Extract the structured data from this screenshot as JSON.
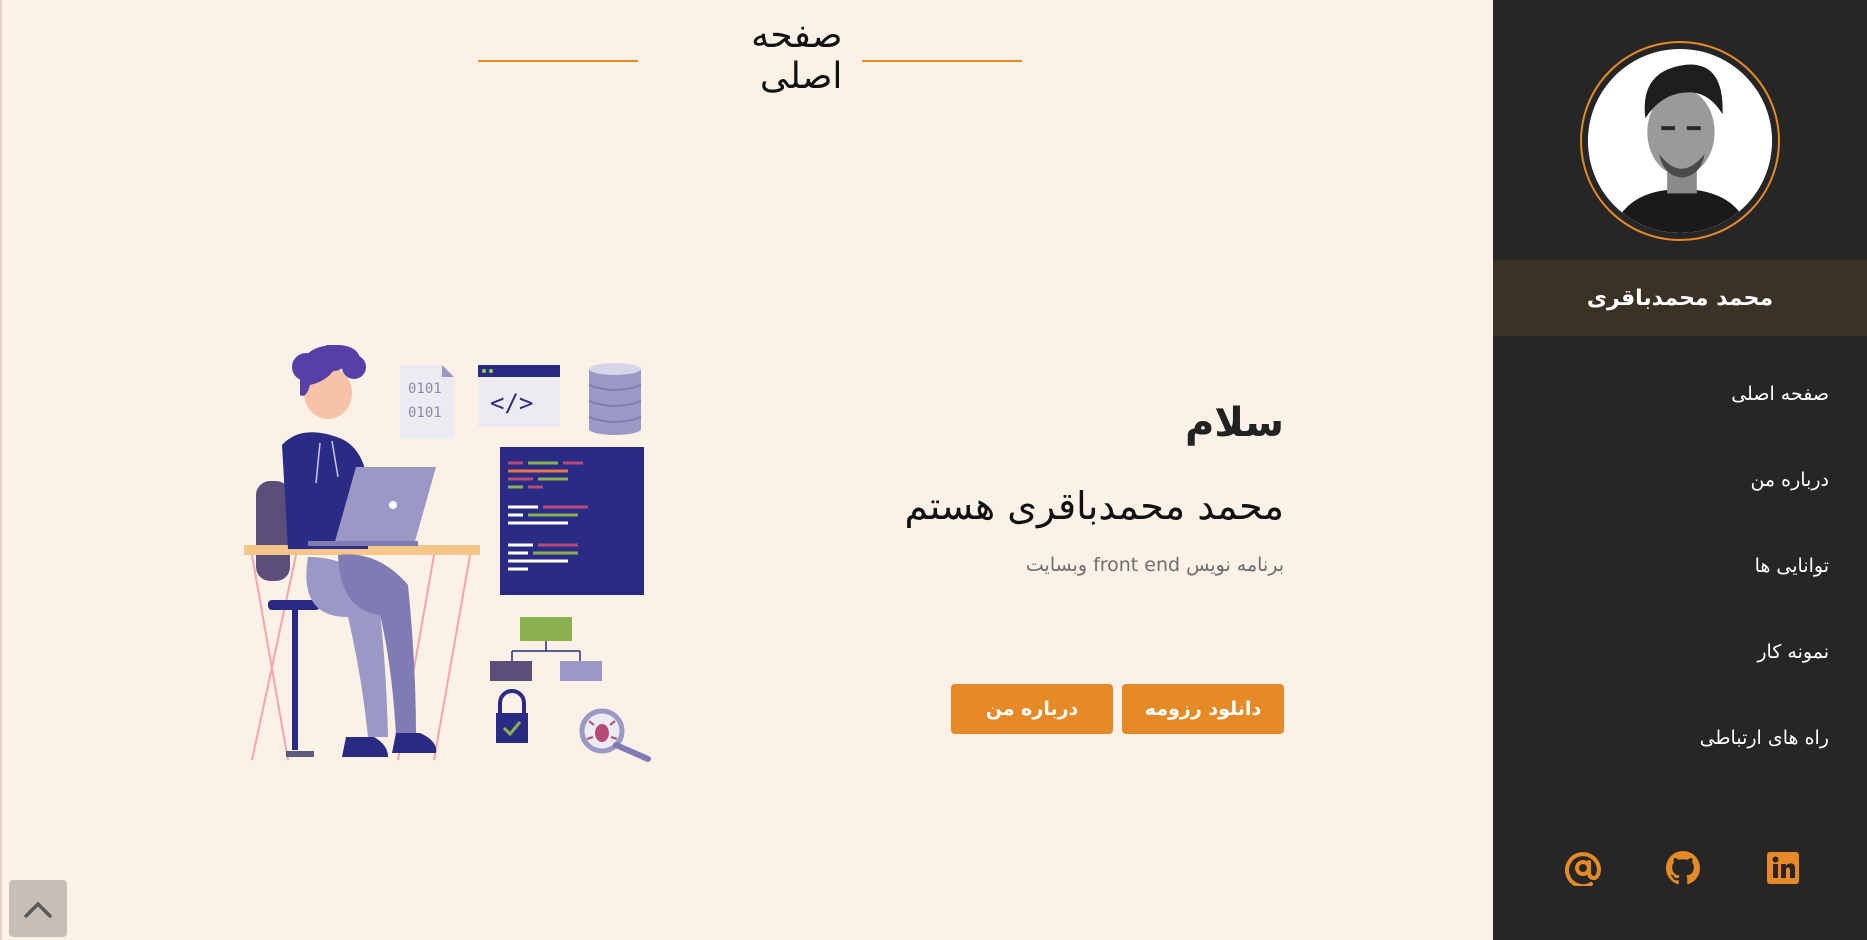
{
  "main": {
    "title": "صفحه اصلی",
    "greeting": "سلام",
    "name_line": "محمد محمدباقری هستم",
    "role": "برنامه نویس front end وبسایت",
    "buttons": {
      "resume": "دانلود رزومه",
      "about": "درباره من"
    },
    "illustration_code": {
      "binary_1": "0101",
      "binary_2": "0101",
      "tag": "</>"
    }
  },
  "sidebar": {
    "name": "محمد محمدباقری",
    "nav": [
      {
        "label": "صفحه اصلی"
      },
      {
        "label": "درباره من"
      },
      {
        "label": "توانایی ها"
      },
      {
        "label": "نمونه کار"
      },
      {
        "label": "راه های ارتباطی"
      }
    ],
    "socials": [
      {
        "icon": "email-icon"
      },
      {
        "icon": "github-icon"
      },
      {
        "icon": "linkedin-icon"
      }
    ]
  },
  "colors": {
    "accent": "#e58a26",
    "page_bg": "#fcf1e7",
    "sidebar_bg": "#262626",
    "name_bar_bg": "#3a3224"
  }
}
